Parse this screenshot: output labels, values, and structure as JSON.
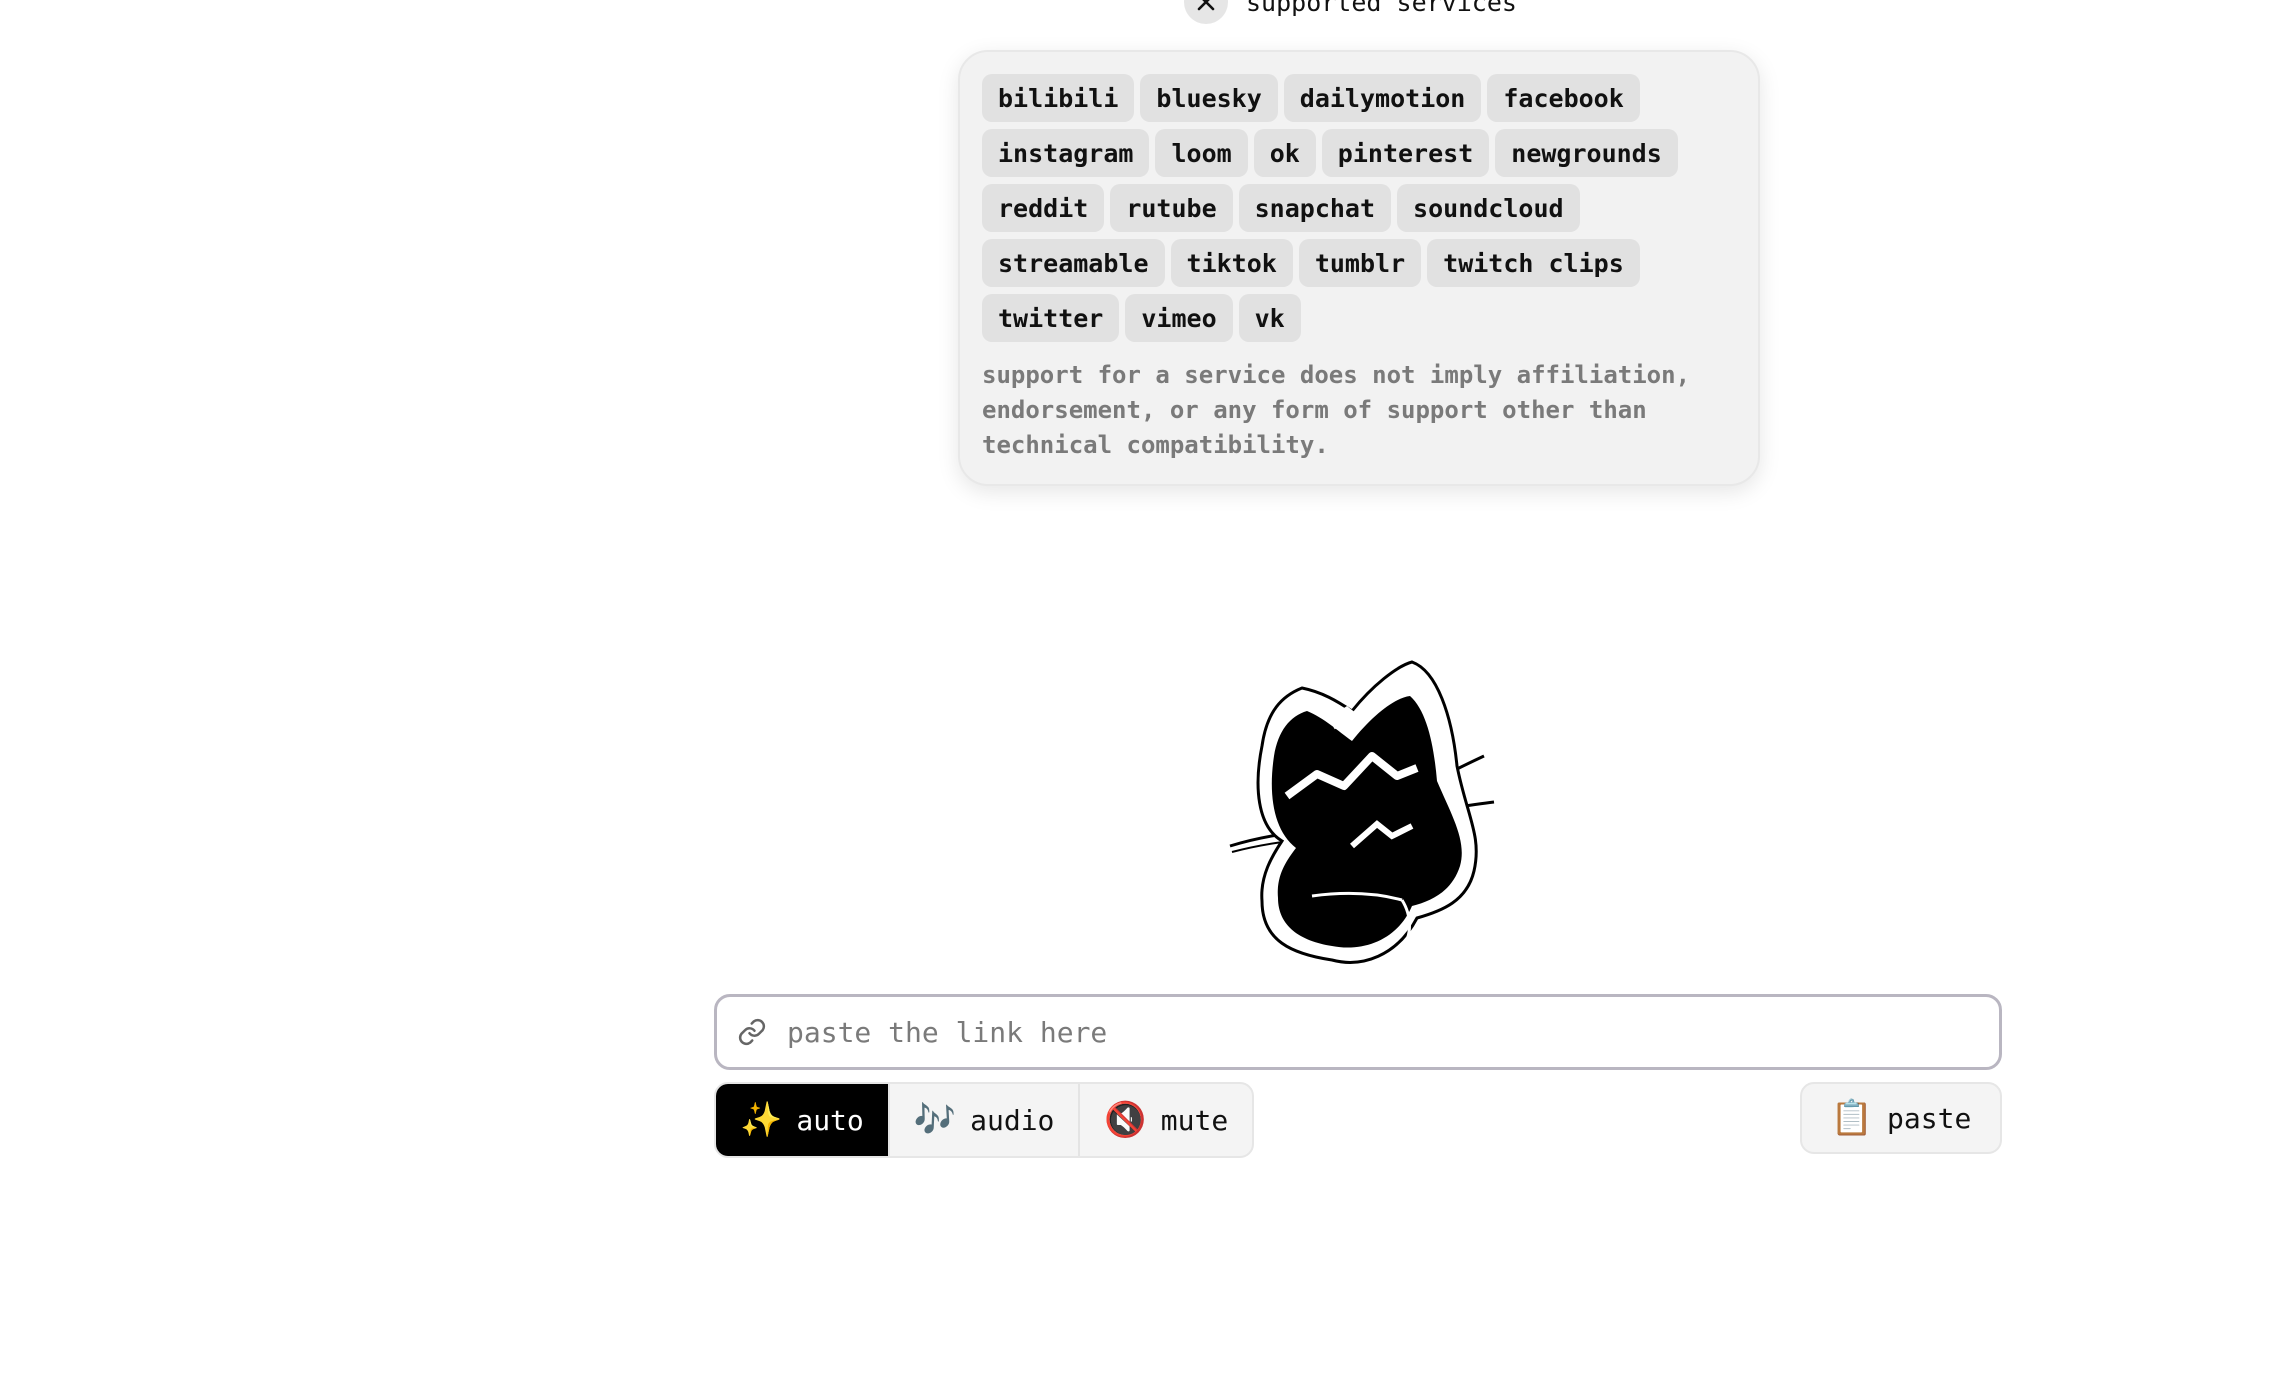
{
  "header": {
    "title": "supported services",
    "close_icon": "close-icon"
  },
  "services": {
    "items": [
      "bilibili",
      "bluesky",
      "dailymotion",
      "facebook",
      "instagram",
      "loom",
      "ok",
      "pinterest",
      "newgrounds",
      "reddit",
      "rutube",
      "snapchat",
      "soundcloud",
      "streamable",
      "tiktok",
      "tumblr",
      "twitch clips",
      "twitter",
      "vimeo",
      "vk"
    ],
    "disclaimer": "support for a service does not imply affiliation, endorsement, or any form of support other than technical compatibility."
  },
  "mascot": {
    "icon": "cat-mascot-icon"
  },
  "link_input": {
    "placeholder": "paste the link here",
    "value": "",
    "icon": "link-icon"
  },
  "modes": [
    {
      "label": "auto",
      "icon": "sparkles-icon",
      "glyph": "✨",
      "active": true
    },
    {
      "label": "audio",
      "icon": "music-notes-icon",
      "glyph": "🎶",
      "active": false
    },
    {
      "label": "mute",
      "icon": "muted-speaker-icon",
      "glyph": "🔇",
      "active": false
    }
  ],
  "paste": {
    "label": "paste",
    "icon": "clipboard-icon",
    "glyph": "📋"
  },
  "colors": {
    "active_mode_bg": "#000000",
    "panel_bg": "#f2f2f2",
    "chip_bg": "#e1e1e1",
    "input_border": "#b9b6c1"
  }
}
